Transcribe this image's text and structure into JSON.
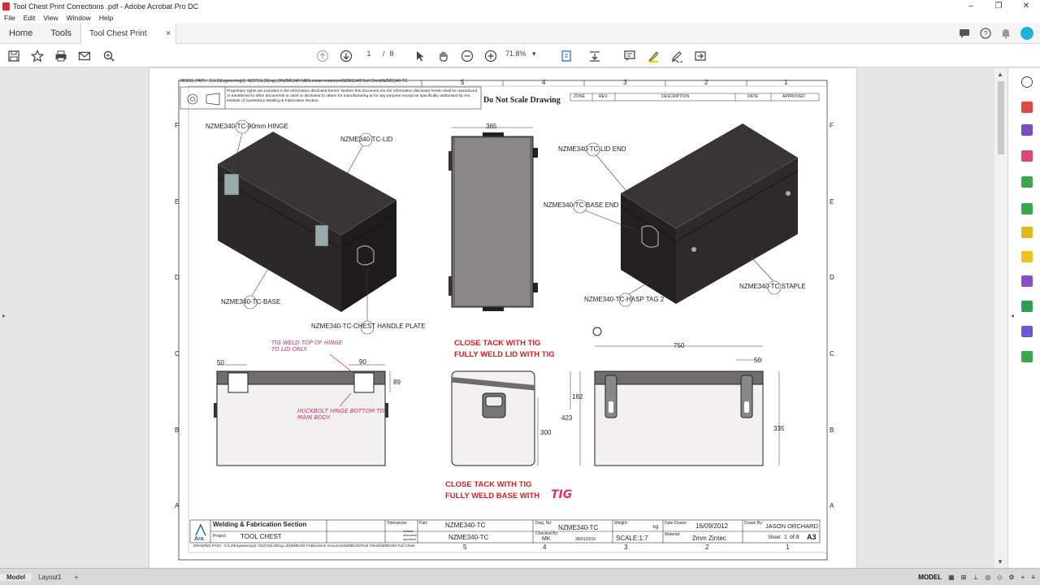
{
  "window": {
    "title": "Tool Chest Print Corrections .pdf - Adobe Acrobat Pro DC",
    "minimize": "–",
    "restore": "❐",
    "close": "✕"
  },
  "menu": [
    "File",
    "Edit",
    "View",
    "Window",
    "Help"
  ],
  "tabs": {
    "home": "Home",
    "tools": "Tools",
    "document": "Tool Chest Print Co...",
    "close": "×"
  },
  "toolbar": {
    "current_page": "1",
    "page_sep": "/",
    "total_pages": "8",
    "zoom": "71.8%"
  },
  "drawing": {
    "model_path": "MODEL PATH : S:\\L3\\Engineering\\3. N22715L3\\Eng.L3\\NZME340 FAB\\Lesson resources\\NZME340\\Tool Chest\\NZME340-TC",
    "disclaimer": "Proprietary rights are included in the information disclosed herein. Neither this document nor the information disclosed herein shall be reproduced or transferred to other documents or used or disclosed to others for manufacturing or for any purpose except as specifically authorised by Ara Institute of Canterbury Welding & Fabrication Section.",
    "no_scale": "Do Not Scale Drawing",
    "rev_headers": [
      "ZONE",
      "REV.",
      "DESCRIPTION",
      "DATE",
      "APPROVED"
    ],
    "col_numbers": [
      "5",
      "4",
      "3",
      "2",
      "1"
    ],
    "row_letters": [
      "F",
      "E",
      "D",
      "C",
      "B",
      "A"
    ],
    "callouts": {
      "hinge": "NZME340-TC-90mm HINGE",
      "lid": "NZME340-TC-LID",
      "base": "NZME340-TC-BASE",
      "handle": "NZME340-TC-CHEST HANDLE PLATE",
      "lid_end": "NZME340-TC-LID END",
      "base_end": "NZME340-TC-BASE END",
      "hasp": "NZME340-TC-HASP TAG 2",
      "staple": "NZME340-TC STAPLE"
    },
    "dims": {
      "w365": "365",
      "d50a": "50",
      "d90": "90",
      "d89": "89",
      "d750": "750",
      "d50b": "50",
      "d182": "182",
      "d423": "423",
      "d300": "300",
      "d335": "335"
    },
    "notes": {
      "tig1": "CLOSE TACK WITH TIG",
      "tig2": "FULLY WELD LID WITH TIG",
      "tig3": "CLOSE TACK WITH TIG",
      "tig4": "FULLY WELD BASE  WITH",
      "tig_hand": "TIG",
      "hand1": "TIG  WELD TOP OF HINGE TO LID ONLY.",
      "hand2": "HUCKBOLT HINGE BOTTOM TO MAIN BODY."
    },
    "titleblock": {
      "section": "Welding & Fabrication Section",
      "project_label": "Project:",
      "project": "TOOL CHEST",
      "logo": "Ara",
      "tol_label": "Tolerances:",
      "tol_note": "Unless otherwise specified",
      "part_label": "Part:",
      "part": "NZME340-TC",
      "part2": "NZME340-TC",
      "dwg_label": "Dwg. No:",
      "dwg": "NZME340-TC",
      "checked_label": "Checked By:",
      "checked": "MK",
      "check_date": "28/01/2016",
      "weight_label": "Weight:",
      "weight_unit": "kg",
      "scale": "SCALE:1:7",
      "date_label": "Date Drawn:",
      "date": "16/09/2012",
      "material_label": "Material:",
      "material": "2mm Zintec",
      "drawn_label": "Drawn By:",
      "drawn": "JASON ORCHARD",
      "sheet": "Sheet",
      "sheet_no": "1",
      "of": "of 8",
      "size": "A3"
    },
    "drawing_path": "DRAWING PATH : S:\\L3\\Engineering\\3. N22715L3\\Eng.L3\\NZME340 FAB\\Lesson resources\\NZME340\\Tool Chest\\NZME340-Tool Chest"
  },
  "statusbar": {
    "model_tab": "Model",
    "layout_tab": "Layout1",
    "add": "+",
    "mode": "MODEL"
  }
}
